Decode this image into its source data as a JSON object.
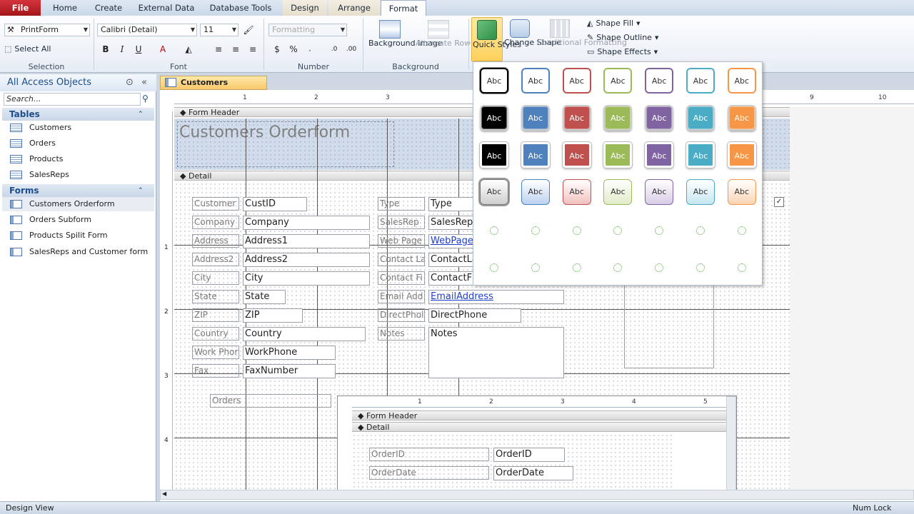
{
  "tabs": [
    "File",
    "Home",
    "Create",
    "External Data",
    "Database Tools",
    "Design",
    "Arrange",
    "Format"
  ],
  "ribbon": {
    "selection": {
      "object_combo": "PrintForm",
      "select_all": "Select All",
      "label": "Selection"
    },
    "font": {
      "font_name": "Calibri (Detail)",
      "font_size": "11",
      "bold": "B",
      "italic": "I",
      "underline": "U",
      "label": "Font"
    },
    "number": {
      "format_combo": "Formatting",
      "currency": "$",
      "percent": "%",
      "label": "Number"
    },
    "background": {
      "bg_image": "Background Image",
      "alt_color": "Alternate Row Color",
      "label": "Background"
    },
    "control": {
      "quick_styles": "Quick Styles",
      "change_shape": "Change Shape",
      "conditional": "Conditional Formatting",
      "shape_fill": "Shape Fill",
      "shape_outline": "Shape Outline",
      "shape_effects": "Shape Effects"
    }
  },
  "nav": {
    "title": "All Access Objects",
    "search_placeholder": "Search...",
    "tables_label": "Tables",
    "tables": [
      "Customers",
      "Orders",
      "Products",
      "SalesReps"
    ],
    "forms_label": "Forms",
    "forms": [
      "Customers Orderform",
      "Orders Subform",
      "Products Spilit Form",
      "SalesReps and Customer form"
    ]
  },
  "doc": {
    "tab_title": "Customers Orderform",
    "form_header": "Form Header",
    "detail": "Detail",
    "header_title": "Customers Orderform",
    "ruler_marks": [
      "1",
      "2",
      "3",
      "4",
      "5",
      "6",
      "7",
      "8",
      "9",
      "10"
    ],
    "vruler_marks": [
      "1",
      "2",
      "3",
      "4"
    ],
    "left_labels": [
      "Customer",
      "Company",
      "Address",
      "Address2",
      "City",
      "State",
      "ZIP",
      "Country",
      "Work Phor",
      "Fax"
    ],
    "left_fields": [
      "CustID",
      "Company",
      "Address1",
      "Address2",
      "City",
      "State",
      "ZIP",
      "Country",
      "WorkPhone",
      "FaxNumber"
    ],
    "right_labels": [
      "Type",
      "SalesRep",
      "Web Page",
      "Contact La",
      "Contact Fi",
      "Email Add",
      "DirectPhol",
      "Notes"
    ],
    "right_fields": [
      "Type",
      "SalesRep",
      "WebPage",
      "ContactLa",
      "ContactF",
      "EmailAddress",
      "DirectPhone",
      "Notes"
    ],
    "orders_label": "Orders",
    "sub_form_header": "Form Header",
    "sub_detail": "Detail",
    "sub_ruler_marks": [
      "1",
      "2",
      "3",
      "4",
      "5"
    ],
    "sub_labels": [
      "OrderID",
      "OrderDate"
    ],
    "sub_fields": [
      "OrderID",
      "OrderDate"
    ]
  },
  "gallery": {
    "swatch_text": "Abc",
    "colors": [
      "#000000",
      "#4f81bd",
      "#c0504d",
      "#9bbb59",
      "#8064a2",
      "#4bacc6",
      "#f79646"
    ],
    "light": [
      "#cfcfcf",
      "#bcd2ef",
      "#f2c0be",
      "#e1ecc8",
      "#d8cce6",
      "#c6e6ef",
      "#fbd5b5"
    ]
  },
  "status": {
    "left": "Design View",
    "right": "Num Lock"
  }
}
